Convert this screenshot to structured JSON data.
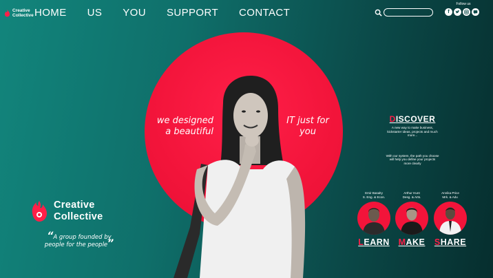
{
  "brand": {
    "short_name_line1": "Creative",
    "short_name_line2": "Collective"
  },
  "nav": {
    "items": [
      "HOME",
      "US",
      "YOU",
      "SUPPORT",
      "CONTACT"
    ]
  },
  "search": {
    "placeholder": ""
  },
  "social": {
    "label": "Follow us",
    "icons": [
      "facebook-icon",
      "twitter-icon",
      "instagram-icon",
      "chat-icon"
    ]
  },
  "hero": {
    "tagline_left_1": "we designed",
    "tagline_left_2": "a beautiful",
    "tagline_right_1": "IT just for",
    "tagline_right_2": "you",
    "circle_color": "#f2143a"
  },
  "logo": {
    "line1": "Creative",
    "line2": "Collective"
  },
  "quote": {
    "line1": "A group founded by",
    "line2": "people for the people"
  },
  "discover": {
    "first_letter": "D",
    "rest": "ISCOVER",
    "paragraph1": "A new way to make business, kickstarter ideas, projects and much more...",
    "paragraph2": "With our system, the path you choose will help you define your projects more clearly"
  },
  "team": [
    {
      "name": "Emir Basalty",
      "role": "S. Eng. & Econ.",
      "first_letter": "L",
      "rest": "EARN"
    },
    {
      "name": "Arthur Hunt",
      "role": "Desg. & Arts.",
      "first_letter": "M",
      "rest": "AKE"
    },
    {
      "name": "Annika Price",
      "role": "Mrk. & Adv.",
      "first_letter": "S",
      "rest": "HARE"
    }
  ],
  "colors": {
    "accent": "#ff1f48",
    "teal": "#12857c"
  }
}
